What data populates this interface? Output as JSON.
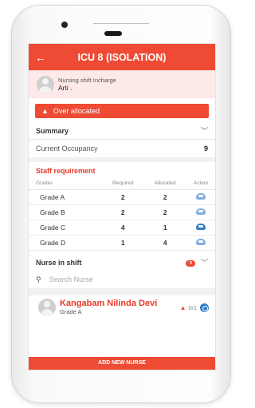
{
  "header": {
    "title": "ICU 8 (ISOLATION)",
    "back_icon": "←"
  },
  "incharge": {
    "label": "Nursing shift Incharge",
    "name": "Arti ."
  },
  "alert": {
    "icon": "▲",
    "text": "Over allocated"
  },
  "summary": {
    "label": "Summary",
    "occupancy_label": "Current Occupancy",
    "occupancy_value": "9"
  },
  "staff": {
    "title": "Staff requirement",
    "columns": [
      "Grades",
      "Required",
      "Allocated",
      "Action"
    ],
    "rows": [
      {
        "grade": "Grade A",
        "required": "2",
        "allocated": "2"
      },
      {
        "grade": "Grade B",
        "required": "2",
        "allocated": "2"
      },
      {
        "grade": "Grade C",
        "required": "4",
        "allocated": "1"
      },
      {
        "grade": "Grade D",
        "required": "1",
        "allocated": "4"
      }
    ]
  },
  "nurse_shift": {
    "label": "Nurse in shift",
    "badge": "9",
    "search_placeholder": "Search Nurse"
  },
  "nurse": {
    "name": "Kangabam Nilinda Devi",
    "grade": "Grade A",
    "count": "0/1"
  },
  "add_button": "ADD NEW NURSE",
  "colors": {
    "accent": "#ef4a34",
    "action_blue": "#2f7ec9"
  }
}
